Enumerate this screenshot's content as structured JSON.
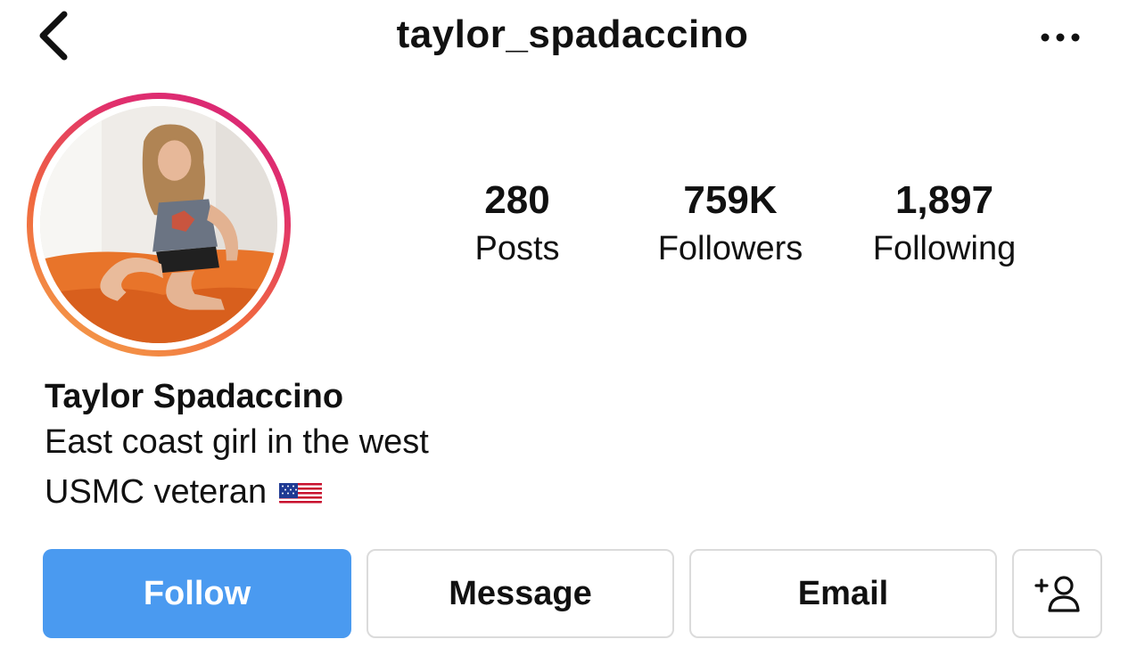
{
  "header": {
    "username": "taylor_spadaccino",
    "back_icon": "chevron-left-icon",
    "more_icon": "more-horizontal-icon"
  },
  "profile": {
    "avatar_alt": "profile photo",
    "story_ring_colors": [
      "#d6247a",
      "#e1306c",
      "#f0693f",
      "#f5a84a"
    ]
  },
  "stats": {
    "posts": {
      "value": "280",
      "label": "Posts"
    },
    "followers": {
      "value": "759K",
      "label": "Followers"
    },
    "following": {
      "value": "1,897",
      "label": "Following"
    }
  },
  "bio": {
    "name": "Taylor Spadaccino",
    "line1": "East coast girl in the west",
    "line2": "USMC veteran",
    "line2_emoji": "us-flag-emoji"
  },
  "actions": {
    "follow_label": "Follow",
    "message_label": "Message",
    "email_label": "Email",
    "add_user_icon": "add-user-icon",
    "accent_color": "#4a9af0"
  }
}
